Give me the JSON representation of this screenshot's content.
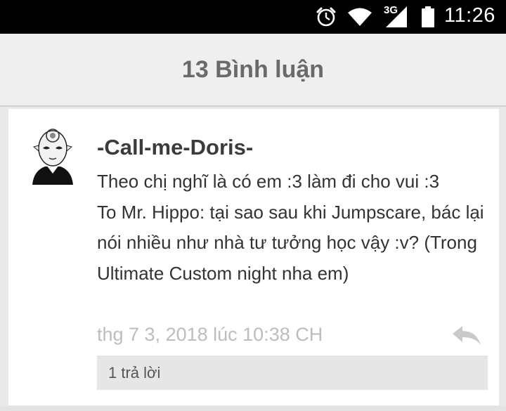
{
  "status_bar": {
    "network_type": "3G",
    "time": "11:26",
    "icons": [
      "alarm-icon",
      "wifi-icon",
      "cellular-signal-icon",
      "battery-icon"
    ]
  },
  "header": {
    "title": "13 Bình luận"
  },
  "comment": {
    "author": "-Call-me-Doris-",
    "avatar": "avatar",
    "body": "Theo chị nghĩ là có em :3 làm đi cho vui :3\nTo Mr. Hippo: tại sao sau khi Jumpscare, bác lại nói nhiều như nhà tư tưởng học vậy :v? (Trong Ultimate Custom night nha em)",
    "timestamp": "thg 7 3, 2018 lúc 10:38 CH",
    "reply_icon": "reply-icon",
    "replies_label": "1 trả lời"
  },
  "colors": {
    "status_bar_bg": "#000000",
    "header_bg": "#efefef",
    "header_text": "#6a6a6a",
    "page_bg": "#e9e9e9",
    "card_bg": "#ffffff",
    "timestamp_text": "#bdbdbd",
    "replies_bg": "#e6e6e6"
  }
}
